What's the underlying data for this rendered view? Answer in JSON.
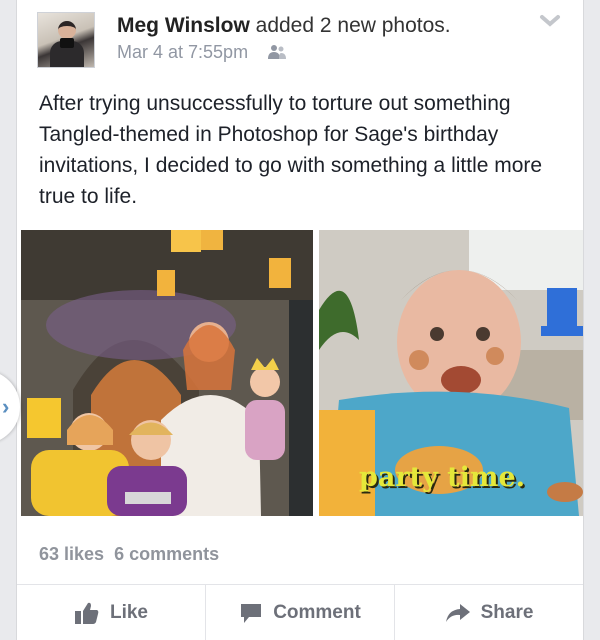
{
  "post": {
    "author": "Meg Winslow",
    "action_text": " added 2 new photos.",
    "timestamp": "Mar 4 at 7:55pm",
    "privacy_icon": "friends-icon",
    "menu_icon": "chevron-down-icon",
    "text": "After trying unsuccessfully to torture out something Tangled-themed in Photoshop for Sage's birthday invitations, I decided to go with something a little more true to life.",
    "photos": [
      {
        "caption": ""
      },
      {
        "caption": "party time."
      }
    ]
  },
  "stats": {
    "likes": "63 likes",
    "comments": "6 comments"
  },
  "actions": {
    "like": "Like",
    "comment": "Comment",
    "share": "Share"
  },
  "side_tab": {
    "glyph": "›"
  },
  "colors": {
    "meta_gray": "#9197a3",
    "caption_yellow": "#e5e83a",
    "side_tab_blue": "#5b8fc0"
  }
}
